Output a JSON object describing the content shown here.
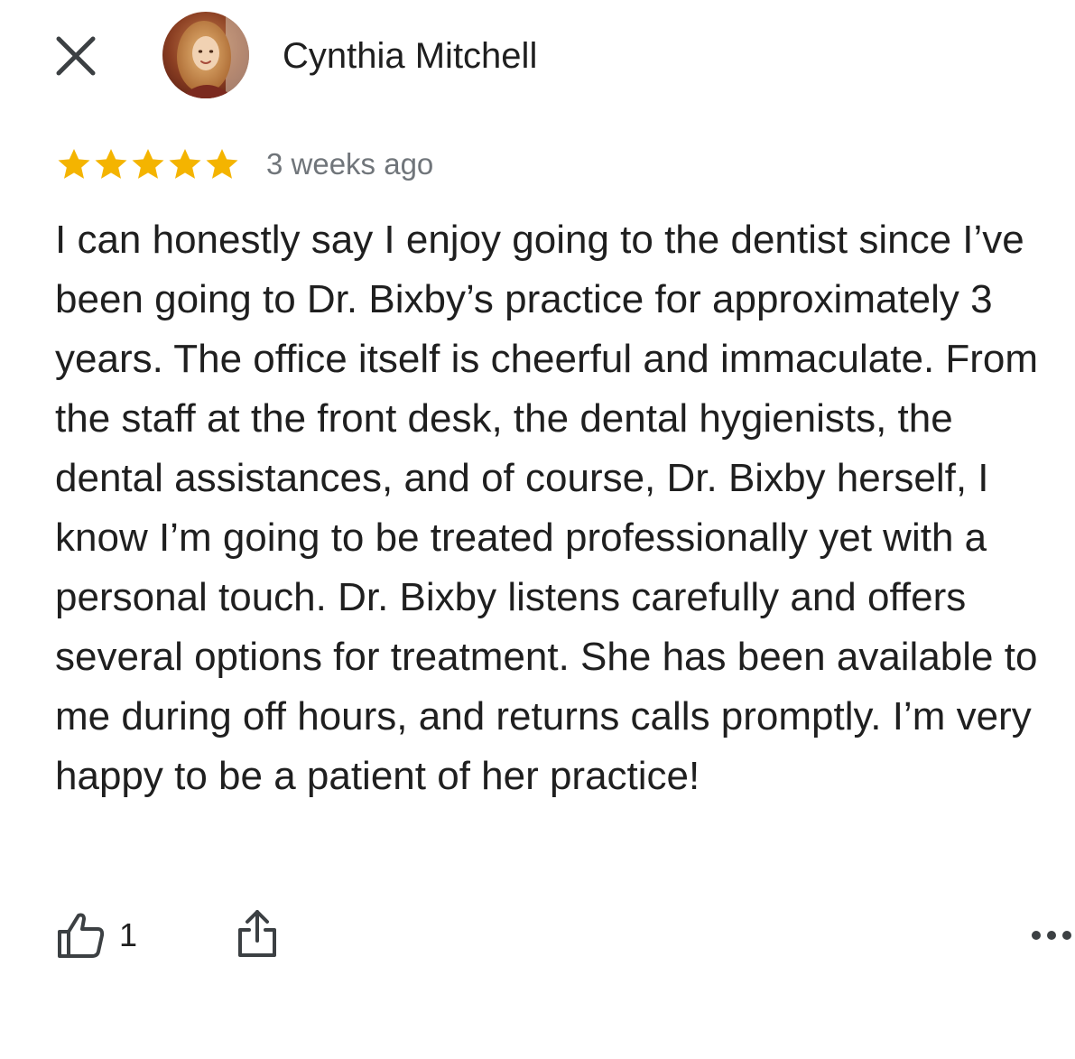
{
  "header": {
    "close_icon": "close-icon",
    "avatar_icon": "avatar",
    "author_name": "Cynthia Mitchell"
  },
  "review": {
    "rating": 5,
    "rating_max": 5,
    "star_color": "#F4B400",
    "date": "3 weeks ago",
    "text": "I can honestly say I enjoy going to the dentist since I’ve been going to Dr. Bixby’s practice for approximately 3 years. The office itself is cheerful and immaculate. From the staff at the front desk, the dental hygienists, the dental assistances, and of course, Dr. Bixby herself, I know I’m going to be treated professionally yet with a personal touch. Dr. Bixby listens carefully and offers several options for treatment. She has been available to me during off hours, and returns calls promptly. I’m very happy to be a patient of her practice!"
  },
  "actions": {
    "like_icon": "thumbs-up-icon",
    "like_count": "1",
    "share_icon": "share-icon",
    "more_icon": "more-options-icon"
  }
}
